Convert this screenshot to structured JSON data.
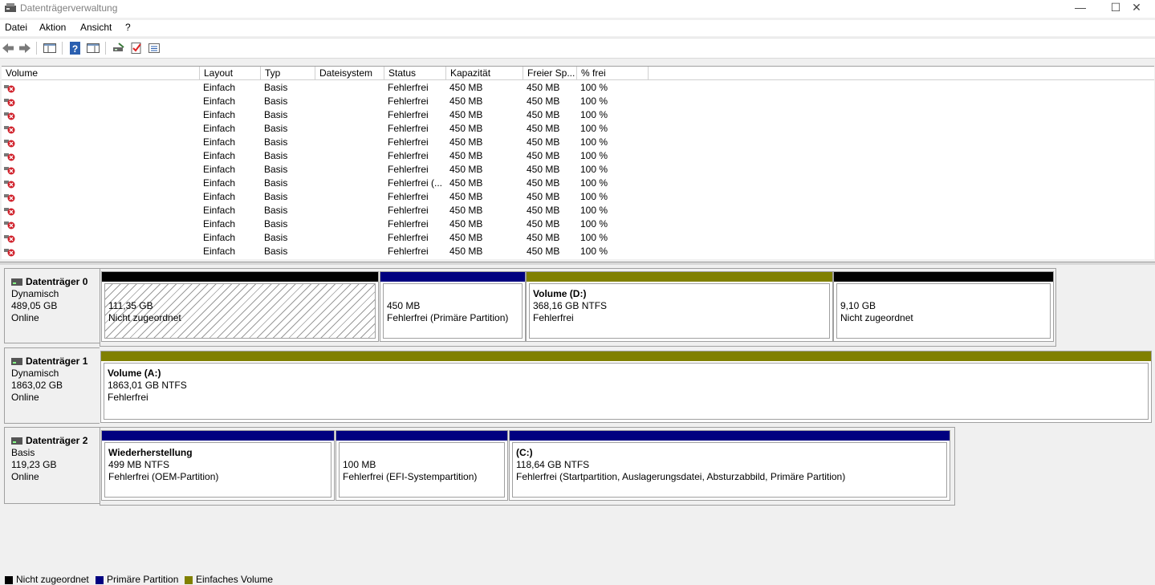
{
  "window": {
    "title": "Datenträgerverwaltung"
  },
  "menu": [
    "Datei",
    "Aktion",
    "Ansicht",
    "?"
  ],
  "columns": [
    "Volume",
    "Layout",
    "Typ",
    "Dateisystem",
    "Status",
    "Kapazität",
    "Freier Sp...",
    "% frei"
  ],
  "rows": [
    {
      "layout": "Einfach",
      "typ": "Basis",
      "fs": "",
      "status": "Fehlerfrei",
      "cap": "450 MB",
      "free": "450 MB",
      "pct": "100 %"
    },
    {
      "layout": "Einfach",
      "typ": "Basis",
      "fs": "",
      "status": "Fehlerfrei",
      "cap": "450 MB",
      "free": "450 MB",
      "pct": "100 %"
    },
    {
      "layout": "Einfach",
      "typ": "Basis",
      "fs": "",
      "status": "Fehlerfrei",
      "cap": "450 MB",
      "free": "450 MB",
      "pct": "100 %"
    },
    {
      "layout": "Einfach",
      "typ": "Basis",
      "fs": "",
      "status": "Fehlerfrei",
      "cap": "450 MB",
      "free": "450 MB",
      "pct": "100 %"
    },
    {
      "layout": "Einfach",
      "typ": "Basis",
      "fs": "",
      "status": "Fehlerfrei",
      "cap": "450 MB",
      "free": "450 MB",
      "pct": "100 %"
    },
    {
      "layout": "Einfach",
      "typ": "Basis",
      "fs": "",
      "status": "Fehlerfrei",
      "cap": "450 MB",
      "free": "450 MB",
      "pct": "100 %"
    },
    {
      "layout": "Einfach",
      "typ": "Basis",
      "fs": "",
      "status": "Fehlerfrei",
      "cap": "450 MB",
      "free": "450 MB",
      "pct": "100 %"
    },
    {
      "layout": "Einfach",
      "typ": "Basis",
      "fs": "",
      "status": "Fehlerfrei (...",
      "cap": "450 MB",
      "free": "450 MB",
      "pct": "100 %"
    },
    {
      "layout": "Einfach",
      "typ": "Basis",
      "fs": "",
      "status": "Fehlerfrei",
      "cap": "450 MB",
      "free": "450 MB",
      "pct": "100 %"
    },
    {
      "layout": "Einfach",
      "typ": "Basis",
      "fs": "",
      "status": "Fehlerfrei",
      "cap": "450 MB",
      "free": "450 MB",
      "pct": "100 %"
    },
    {
      "layout": "Einfach",
      "typ": "Basis",
      "fs": "",
      "status": "Fehlerfrei",
      "cap": "450 MB",
      "free": "450 MB",
      "pct": "100 %"
    },
    {
      "layout": "Einfach",
      "typ": "Basis",
      "fs": "",
      "status": "Fehlerfrei",
      "cap": "450 MB",
      "free": "450 MB",
      "pct": "100 %"
    },
    {
      "layout": "Einfach",
      "typ": "Basis",
      "fs": "",
      "status": "Fehlerfrei",
      "cap": "450 MB",
      "free": "450 MB",
      "pct": "100 %"
    }
  ],
  "disks": [
    {
      "name": "Datenträger 0",
      "type": "Dynamisch",
      "size": "489,05 GB",
      "state": "Online",
      "partitions": [
        {
          "title": "",
          "size": "111,35 GB",
          "status": "Nicht zugeordnet"
        },
        {
          "title": "",
          "size": "450 MB",
          "status": "Fehlerfrei (Primäre Partition)"
        },
        {
          "title": "Volume  (D:)",
          "size": "368,16 GB NTFS",
          "status": "Fehlerfrei"
        },
        {
          "title": "",
          "size": "9,10 GB",
          "status": "Nicht zugeordnet"
        }
      ]
    },
    {
      "name": "Datenträger 1",
      "type": "Dynamisch",
      "size": "1863,02 GB",
      "state": "Online",
      "partitions": [
        {
          "title": "Volume  (A:)",
          "size": "1863,01 GB NTFS",
          "status": "Fehlerfrei"
        }
      ]
    },
    {
      "name": "Datenträger 2",
      "type": "Basis",
      "size": "119,23 GB",
      "state": "Online",
      "partitions": [
        {
          "title": "Wiederherstellung",
          "size": "499 MB NTFS",
          "status": "Fehlerfrei (OEM-Partition)"
        },
        {
          "title": "",
          "size": "100 MB",
          "status": "Fehlerfrei (EFI-Systempartition)"
        },
        {
          "title": " (C:)",
          "size": "118,64 GB NTFS",
          "status": "Fehlerfrei (Startpartition, Auslagerungsdatei, Absturzabbild, Primäre Partition)"
        }
      ]
    }
  ],
  "legend": [
    {
      "label": "Nicht zugeordnet",
      "color": "#000000"
    },
    {
      "label": "Primäre Partition",
      "color": "#000080"
    },
    {
      "label": "Einfaches Volume",
      "color": "#808000"
    }
  ],
  "colors": {
    "unallocated": "#000000",
    "primary": "#000080",
    "simple": "#808000"
  }
}
